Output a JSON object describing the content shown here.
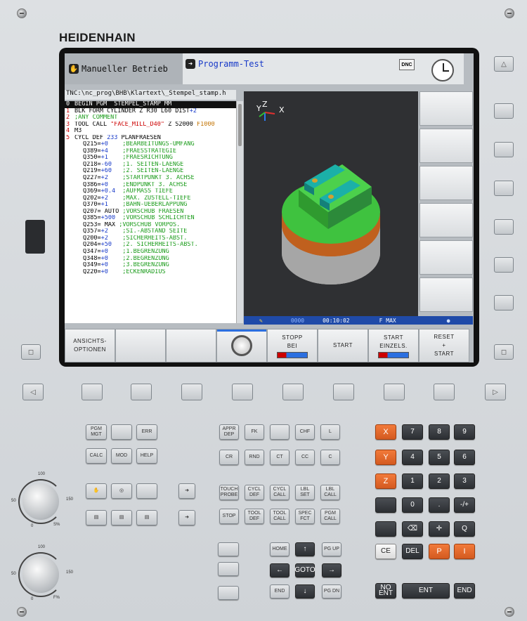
{
  "brand": "HEIDENHAIN",
  "modes": {
    "left": "Manueller Betrieb",
    "right": "Programm-Test",
    "left_icon": "hand-icon",
    "right_icon": "arrow-right-icon"
  },
  "dnc": "DNC",
  "path": "TNC:\\nc_prog\\BHB\\Klartext\\_Stempel_stamp.h",
  "program_lines": [
    {
      "n": "0",
      "t": "BEGIN PGM  STEMPEL_STAMP MM",
      "sel": true
    },
    {
      "n": "1",
      "t": "BLK FORM CYLINDER Z R30 L60 DIST",
      "tail": "+2"
    },
    {
      "n": "2",
      "t": ";ANY COMMENT",
      "comment": true
    },
    {
      "n": "3",
      "t": "TOOL CALL ",
      "tool": "\"FACE_MILL_D40\"",
      "t2": " Z S2000 ",
      "feed": "F1000"
    },
    {
      "n": "4",
      "t": "M3"
    },
    {
      "n": "5",
      "t": "CYCL DEF ",
      "num": "233",
      "t2": " PLANFRAESEN"
    },
    {
      "n": "",
      "p": "Q215=",
      "v": "+0",
      "c": ";BEARBEITUNGS-UMFANG"
    },
    {
      "n": "",
      "p": "Q389=",
      "v": "+4",
      "c": ";FRAESSTRATEGIE"
    },
    {
      "n": "",
      "p": "Q350=",
      "v": "+1",
      "c": ";FRAESRICHTUNG"
    },
    {
      "n": "",
      "p": "Q218=",
      "v": "-60",
      "c": ";1. SEITEN-LAENGE"
    },
    {
      "n": "",
      "p": "Q219=",
      "v": "+60",
      "c": ";2. SEITEN-LAENGE"
    },
    {
      "n": "",
      "p": "Q227=",
      "v": "+2",
      "c": ";STARTPUNKT 3. ACHSE"
    },
    {
      "n": "",
      "p": "Q386=",
      "v": "+0",
      "c": ";ENDPUNKT 3. ACHSE"
    },
    {
      "n": "",
      "p": "Q369=",
      "v": "+0.4",
      "c": ";AUFMASS TIEFE"
    },
    {
      "n": "",
      "p": "Q202=",
      "v": "+2",
      "c": ";MAX. ZUSTELL-TIEFE"
    },
    {
      "n": "",
      "p": "Q370=",
      "v": "+1",
      "c": ";BAHN-UEBERLAPPUNG"
    },
    {
      "n": "",
      "p": "Q207= ",
      "v2": "AUTO",
      "c": " ;VORSCHUB FRAESEN"
    },
    {
      "n": "",
      "p": "Q385=",
      "v": "+500",
      "c": ";VORSCHUB SCHLICHTEN"
    },
    {
      "n": "",
      "p": "Q253= ",
      "v2": "MAX",
      "c": " ;VORSCHUB VORPOS."
    },
    {
      "n": "",
      "p": "Q357=",
      "v": "+2",
      "c": ";SI.-ABSTAND SEITE"
    },
    {
      "n": "",
      "p": "Q200=",
      "v": "+2",
      "c": ";SICHERHEITS-ABST."
    },
    {
      "n": "",
      "p": "Q204=",
      "v": "+50",
      "c": ";2. SICHERHEITS-ABST."
    },
    {
      "n": "",
      "p": "Q347=",
      "v": "+0",
      "c": ";1.BEGRENZUNG"
    },
    {
      "n": "",
      "p": "Q348=",
      "v": "+0",
      "c": ";2.BEGRENZUNG"
    },
    {
      "n": "",
      "p": "Q349=",
      "v": "+0",
      "c": ";3.BEGRENZUNG"
    },
    {
      "n": "",
      "p": "Q220=",
      "v": "+0",
      "c": ";ECKENRADIUS"
    }
  ],
  "view_axes": {
    "y": "Y",
    "z": "Z",
    "x": "X"
  },
  "status": {
    "time": "00:10:02",
    "feed": "F MAX",
    "dots": "0000"
  },
  "softkeys": [
    {
      "l1": "ANSICHTS-",
      "l2": "OPTIONEN"
    },
    {
      "l1": "",
      "l2": ""
    },
    {
      "l1": "",
      "l2": ""
    },
    {
      "l1": "",
      "l2": ""
    },
    {
      "l1": "",
      "l2": "",
      "knob": true
    },
    {
      "l1": "STOPP",
      "l2": "BEI",
      "icon": true
    },
    {
      "l1": "START",
      "l2": ""
    },
    {
      "l1": "START",
      "l2": "EINZELS.",
      "icon": true
    },
    {
      "l1": "RESET",
      "l2": "+",
      "l3": "START"
    }
  ],
  "keys": {
    "pgm_mgt": "PGM\nMGT",
    "err": "ERR",
    "calc": "CALC",
    "mod": "MOD",
    "help": "HELP",
    "appr_dep": "APPR\nDEP",
    "fk": "FK",
    "chf": "CHF",
    "l": "L",
    "cr": "CR",
    "rnd": "RND",
    "ct": "CT",
    "cc": "CC",
    "c": "C",
    "touch_probe": "TOUCH\nPROBE",
    "cycl_def": "CYCL\nDEF",
    "cycl_call": "CYCL\nCALL",
    "lbl_set": "LBL\nSET",
    "lbl_call": "LBL\nCALL",
    "stop": "STOP",
    "tool_def": "TOOL\nDEF",
    "tool_call": "TOOL\nCALL",
    "spec_fct": "SPEC\nFCT",
    "pgm_call": "PGM\nCALL",
    "home": "HOME",
    "pg_up": "PG UP",
    "goto": "GOTO",
    "end": "END",
    "pg_dn": "PG DN",
    "x": "X",
    "y": "Y",
    "z": "Z",
    "n7": "7",
    "n8": "8",
    "n9": "9",
    "n4": "4",
    "n5": "5",
    "n6": "6",
    "n1": "1",
    "n2": "2",
    "n3": "3",
    "n0": "0",
    "dot": ".",
    "pm": "-/+",
    "q": "Q",
    "ce": "CE",
    "del": "DEL",
    "p": "P",
    "i": "I",
    "no_ent": "NO\nENT",
    "ent": "ENT",
    "end2": "END"
  },
  "overrides": [
    {
      "v100": "100",
      "v50": "50",
      "v0": "0",
      "v150": "150",
      "label": "S%"
    },
    {
      "v100": "100",
      "v50": "50",
      "v0": "0",
      "v150": "150",
      "label": "F%"
    }
  ]
}
